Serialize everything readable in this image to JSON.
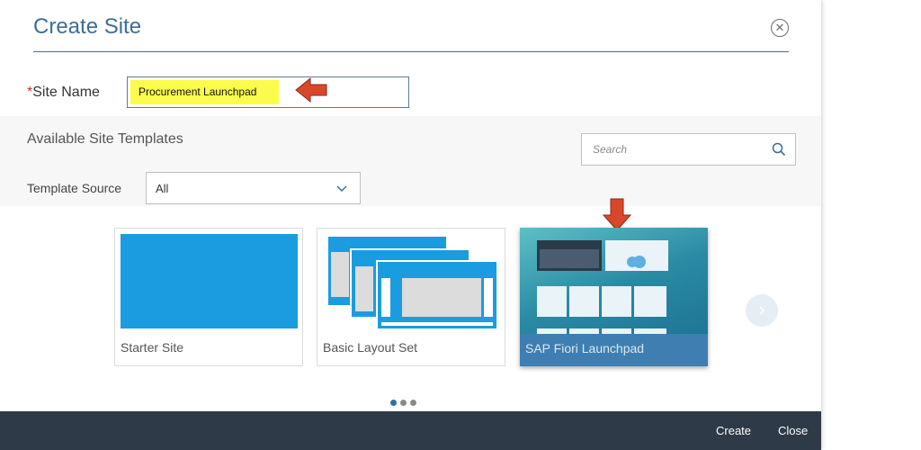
{
  "dialog": {
    "title": "Create Site",
    "close_icon": "close-circle-icon"
  },
  "site_name": {
    "required_mark": "*",
    "label": "Site Name",
    "value": "Procurement Launchpad"
  },
  "templates": {
    "heading": "Available Site Templates",
    "search_placeholder": "Search",
    "source_label": "Template Source",
    "source_value": "All",
    "cards": [
      {
        "label": "Starter Site"
      },
      {
        "label": "Basic Layout Set"
      },
      {
        "label": "SAP Fiori Launchpad",
        "selected": true
      }
    ],
    "pagination": {
      "pages": 3,
      "current": 1
    }
  },
  "footer": {
    "create_label": "Create",
    "close_label": "Close"
  },
  "colors": {
    "title": "#3b6e98",
    "footer_bg": "#2e3a48",
    "highlight": "#fbfb4c",
    "annotation_arrow": "#d9472b",
    "starter_blue": "#1b9ce0"
  }
}
